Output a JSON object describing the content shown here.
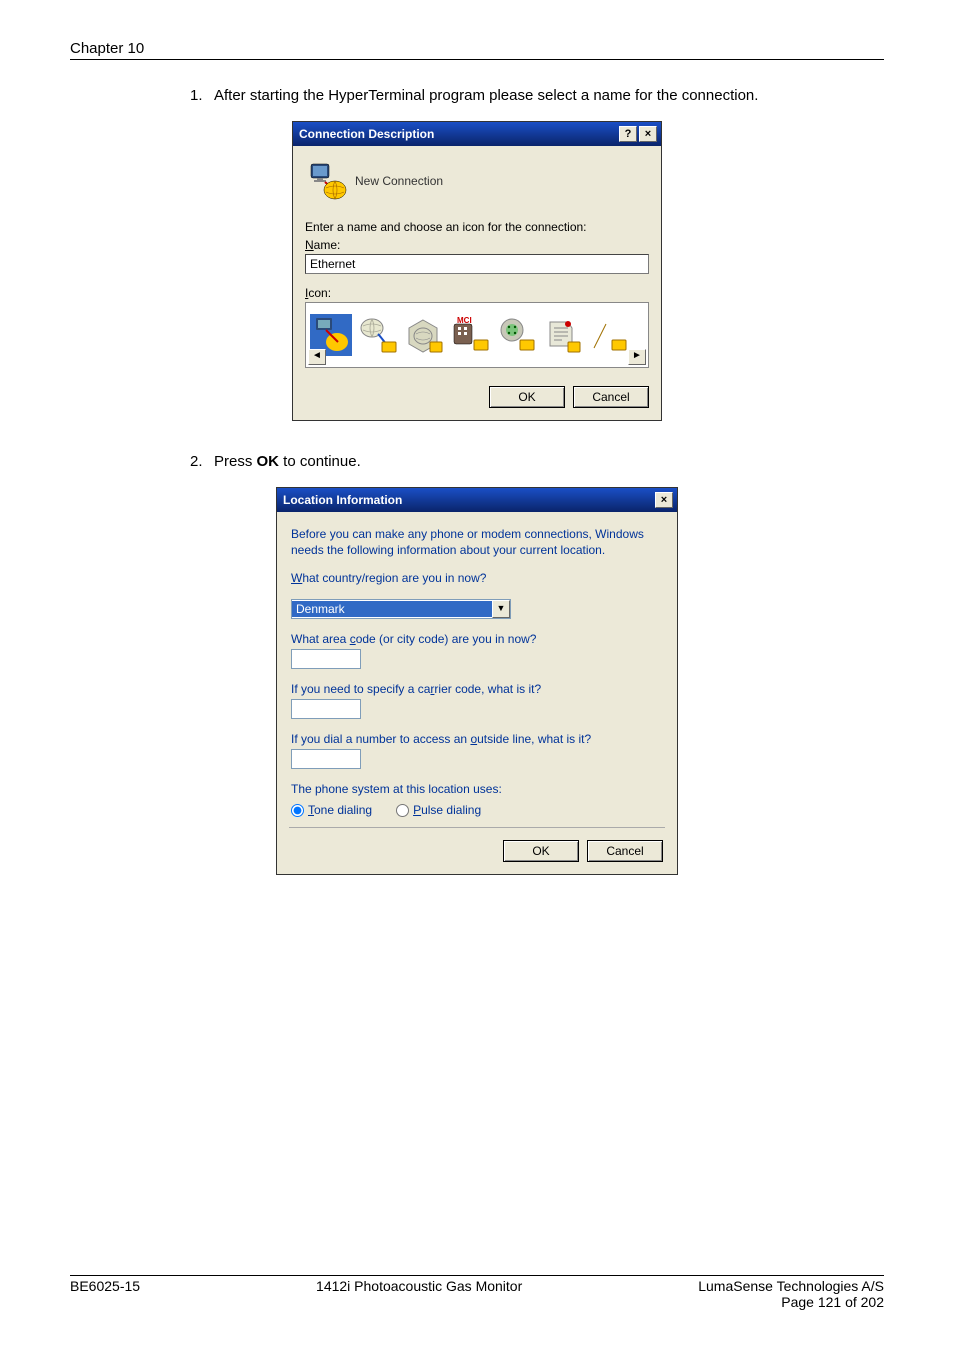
{
  "header": {
    "chapter": "Chapter 10"
  },
  "steps": {
    "s1_num": "1.",
    "s1_text": "After starting the HyperTerminal program please select a name for the connection.",
    "s2_num": "2.",
    "s2_text_a": "Press ",
    "s2_text_b": "OK",
    "s2_text_c": " to continue."
  },
  "dialog1": {
    "title": "Connection Description",
    "help": "?",
    "close": "×",
    "new_conn": "New Connection",
    "enter_name": "Enter a name and choose an icon for the connection:",
    "name_u": "N",
    "name_rest": "ame:",
    "name_value": "Ethernet",
    "icon_u": "I",
    "icon_rest": "con:",
    "left_arrow": "◄",
    "right_arrow": "►",
    "ok": "OK",
    "cancel": "Cancel"
  },
  "dialog2": {
    "title": "Location Information",
    "close": "×",
    "intro": "Before you can make any phone or modem connections, Windows needs the following information about your current location.",
    "q1_u": "W",
    "q1_rest": "hat country/region are you in now?",
    "country": "Denmark",
    "dd_arrow": "▼",
    "q2_a": "What area ",
    "q2_u": "c",
    "q2_b": "ode (or city code) are you in now?",
    "q3_a": "If you need to specify a ca",
    "q3_u": "r",
    "q3_b": "rier code, what is it?",
    "q4_a": "If you dial a number to access an ",
    "q4_u": "o",
    "q4_b": "utside line, what is it?",
    "phone_sys": "The phone system at this location uses:",
    "tone_u": "T",
    "tone_rest": "one dialing",
    "pulse_u": "P",
    "pulse_rest": "ulse dialing",
    "ok": "OK",
    "cancel": "Cancel"
  },
  "footer": {
    "left": "BE6025-15",
    "center": "1412i Photoacoustic Gas Monitor",
    "right": "LumaSense Technologies A/S",
    "page": "Page 121 of 202"
  }
}
